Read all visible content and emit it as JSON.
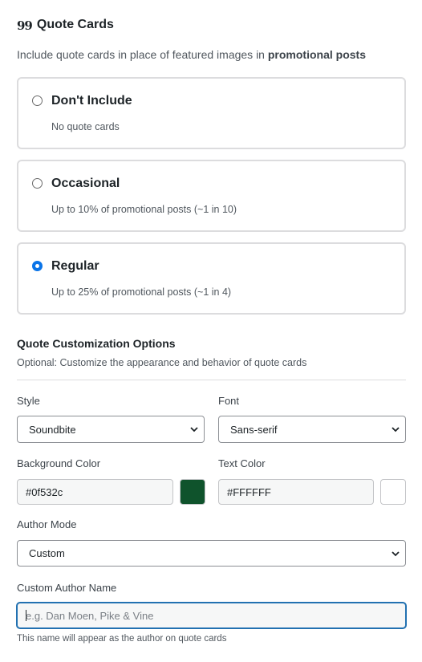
{
  "header": {
    "title": "Quote Cards",
    "icon": "quote-icon"
  },
  "description": {
    "prefix": "Include quote cards in place of featured images in ",
    "emphasis": "promotional posts"
  },
  "options": [
    {
      "title": "Don't Include",
      "subtitle": "No quote cards",
      "selected": false
    },
    {
      "title": "Occasional",
      "subtitle": "Up to 10% of promotional posts (~1 in 10)",
      "selected": false
    },
    {
      "title": "Regular",
      "subtitle": "Up to 25% of promotional posts (~1 in 4)",
      "selected": true
    }
  ],
  "customization": {
    "title": "Quote Customization Options",
    "subtitle": "Optional: Customize the appearance and behavior of quote cards",
    "style": {
      "label": "Style",
      "value": "Soundbite"
    },
    "font": {
      "label": "Font",
      "value": "Sans-serif"
    },
    "background_color": {
      "label": "Background Color",
      "value": "#0f532c",
      "swatch": "#0f532c"
    },
    "text_color": {
      "label": "Text Color",
      "value": "#FFFFFF",
      "swatch": "#FFFFFF"
    },
    "author_mode": {
      "label": "Author Mode",
      "value": "Custom"
    },
    "custom_author": {
      "label": "Custom Author Name",
      "placeholder": "e.g. Dan Moen, Pike & Vine",
      "value": "",
      "hint": "This name will appear as the author on quote cards"
    }
  },
  "colors": {
    "accent": "#0a74e8",
    "focus": "#2271b1",
    "border": "#dcdcde"
  }
}
